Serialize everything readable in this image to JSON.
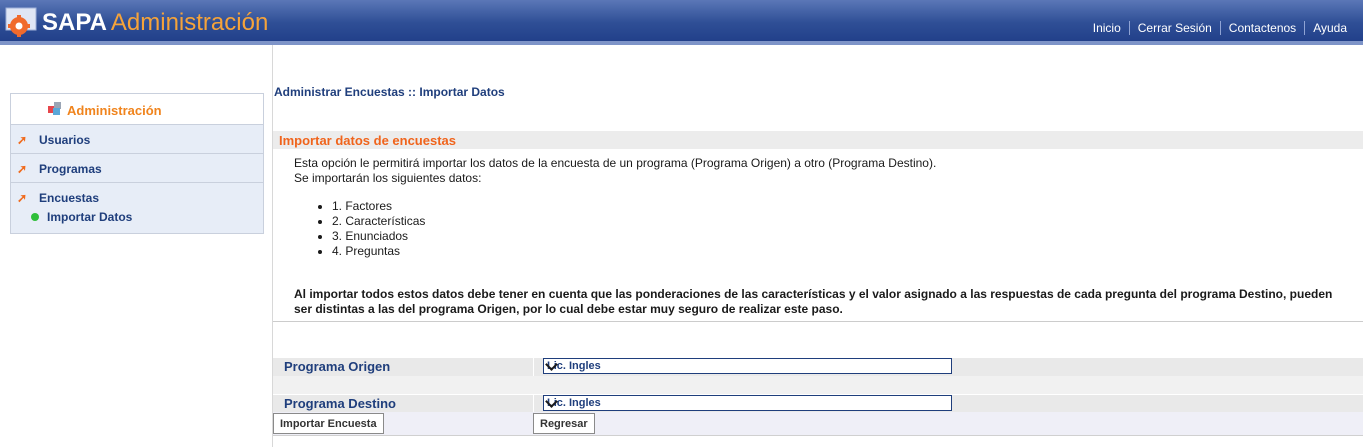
{
  "header": {
    "brand_main": "SAPA",
    "brand_sub": "Administración",
    "nav": [
      {
        "label": "Inicio"
      },
      {
        "label": "Cerrar Sesión"
      },
      {
        "label": "Contactenos"
      },
      {
        "label": "Ayuda"
      }
    ]
  },
  "sidebar": {
    "title": "Administración",
    "items": [
      {
        "label": "Usuarios"
      },
      {
        "label": "Programas"
      },
      {
        "label": "Encuestas",
        "sub": "Importar Datos"
      }
    ]
  },
  "main": {
    "breadcrumb": "Administrar Encuestas :: Importar Datos",
    "section_title": "Importar datos de encuestas",
    "intro_line1": "Esta opción le permitirá importar los datos de la encuesta de un programa (Programa Origen) a otro (Programa Destino).",
    "intro_line2": "Se importarán los siguientes datos:",
    "list": [
      "1. Factores",
      "2. Características",
      "3. Enunciados",
      "4. Preguntas"
    ],
    "warning": "Al importar todos estos datos debe tener en cuenta que las ponderaciones de las características y el valor asignado a las respuestas de cada pregunta del programa Destino, pueden ser distintas a las del programa Origen, por lo cual debe estar muy seguro de realizar este paso."
  },
  "form": {
    "origen_label": "Programa Origen",
    "origen_value": "Lic. Ingles",
    "destino_label": "Programa Destino",
    "destino_value": "Lic. Ingles",
    "import_button": "Importar Encuesta",
    "back_button": "Regresar"
  },
  "colors": {
    "header_blue": "#2f4f96",
    "accent_orange": "#f0641c",
    "link_blue": "#1f3e7c"
  }
}
